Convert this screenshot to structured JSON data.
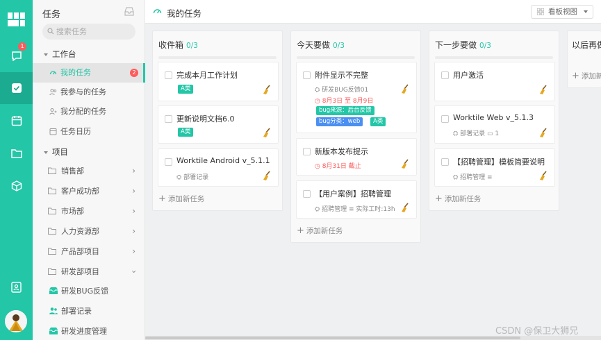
{
  "rail": {
    "notify_badge": "1",
    "icons": [
      "logo-icon",
      "message-icon",
      "task-icon",
      "calendar-icon",
      "folder-icon",
      "cube-icon",
      "contacts-icon"
    ]
  },
  "sidebar": {
    "title": "任务",
    "search_placeholder": "搜索任务",
    "workbench_label": "工作台",
    "nav": [
      {
        "label": "我的任务",
        "count": "2"
      },
      {
        "label": "我参与的任务"
      },
      {
        "label": "我分配的任务"
      },
      {
        "label": "任务日历"
      }
    ],
    "projects_label": "项目",
    "projects": [
      {
        "label": "销售部"
      },
      {
        "label": "客户成功部"
      },
      {
        "label": "市场部"
      },
      {
        "label": "人力资源部"
      },
      {
        "label": "产品部项目"
      },
      {
        "label": "研发部项目"
      }
    ],
    "sub_projects": [
      {
        "label": "研发BUG反馈"
      },
      {
        "label": "部署记录"
      },
      {
        "label": "研发进度管理"
      }
    ]
  },
  "topbar": {
    "title": "我的任务",
    "view_label": "看板视图"
  },
  "columns": [
    {
      "title": "收件箱",
      "count": "0/3",
      "cards": [
        {
          "title": "完成本月工作计划",
          "tag": "A类"
        },
        {
          "title": "更新说明文档6.0",
          "tag": "A类"
        },
        {
          "title": "Worktile Android v_5.1.1",
          "project": "部署记录"
        }
      ],
      "add_label": "添加新任务"
    },
    {
      "title": "今天要做",
      "count": "0/3",
      "cards": [
        {
          "title": "附件显示不完整",
          "project": "研发BUG反馈01",
          "date": "8月3日 至 8月9日",
          "tag1": "bug来源：后台反馈",
          "tag2": "bug分类：web",
          "tag3": "A类"
        },
        {
          "title": "新版本发布提示",
          "date": "8月31日 截止"
        },
        {
          "title": "【用户案例】招聘管理",
          "project": "招聘管理",
          "extra": "实际工时:13h"
        }
      ],
      "add_label": "添加新任务"
    },
    {
      "title": "下一步要做",
      "count": "0/3",
      "cards": [
        {
          "title": "用户激活"
        },
        {
          "title": "Worktile Web v_5.1.3",
          "project": "部署记录",
          "comments": "1"
        },
        {
          "title": "【招聘管理】模板简要说明",
          "project": "招聘管理"
        }
      ],
      "add_label": "添加新任务"
    },
    {
      "title": "以后再做",
      "add_label": "添加新"
    }
  ],
  "watermark": "CSDN @保卫大狮兄",
  "colors": {
    "accent": "#23c6a7",
    "danger": "#ff5b5b",
    "tag_blue": "#4b8ff2"
  }
}
